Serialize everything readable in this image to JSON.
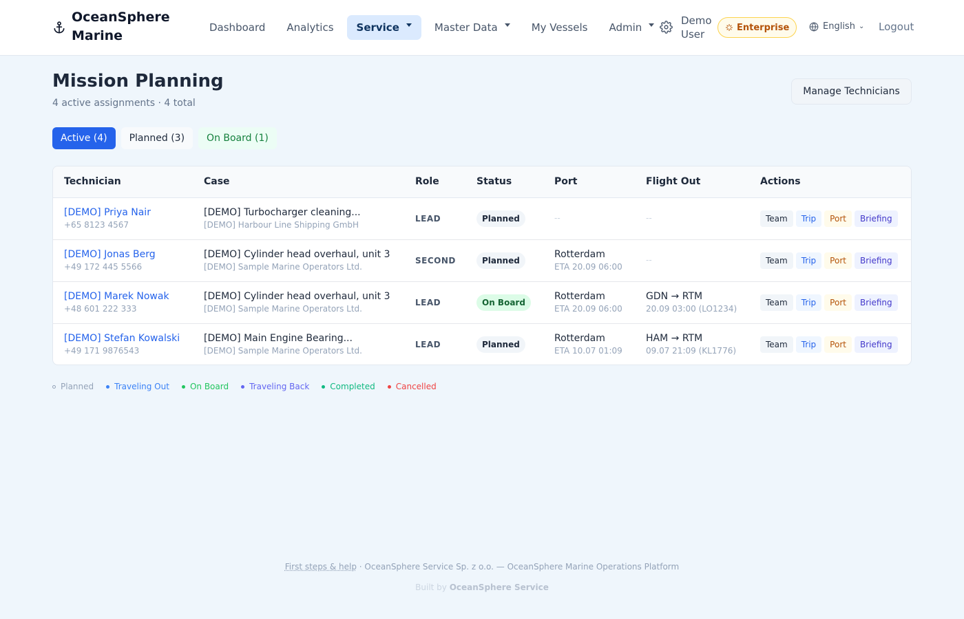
{
  "header": {
    "brand": "OceanSphere Marine",
    "nav": [
      {
        "label": "Dashboard"
      },
      {
        "label": "Analytics"
      },
      {
        "label": "Service"
      },
      {
        "label": "Master Data"
      },
      {
        "label": "My Vessels"
      },
      {
        "label": "Admin"
      }
    ],
    "user": "Demo User",
    "plan_badge": "Enterprise",
    "language": "English",
    "logout": "Logout"
  },
  "page": {
    "title": "Mission Planning",
    "subtitle": "4 active assignments · 4 total",
    "manage_button": "Manage Technicians"
  },
  "tabs": [
    {
      "label": "Active (4)"
    },
    {
      "label": "Planned (3)"
    },
    {
      "label": "On Board (1)"
    }
  ],
  "table": {
    "columns": [
      "Technician",
      "Case",
      "Role",
      "Status",
      "Port",
      "Flight Out",
      "Actions"
    ],
    "action_labels": [
      "Team",
      "Trip",
      "Port",
      "Briefing"
    ],
    "rows": [
      {
        "technician": "[DEMO] Priya Nair",
        "phone": "+65 8123 4567",
        "case": "[DEMO] Turbocharger cleaning...",
        "company": "[DEMO] Harbour Line Shipping GmbH",
        "role": "LEAD",
        "status": "Planned",
        "port": "--",
        "eta": "",
        "flight": "--",
        "flight_detail": ""
      },
      {
        "technician": "[DEMO] Jonas Berg",
        "phone": "+49 172 445 5566",
        "case": "[DEMO] Cylinder head overhaul, unit 3",
        "company": "[DEMO] Sample Marine Operators Ltd.",
        "role": "SECOND",
        "status": "Planned",
        "port": "Rotterdam",
        "eta": "ETA 20.09 06:00",
        "flight": "--",
        "flight_detail": ""
      },
      {
        "technician": "[DEMO] Marek Nowak",
        "phone": "+48 601 222 333",
        "case": "[DEMO] Cylinder head overhaul, unit 3",
        "company": "[DEMO] Sample Marine Operators Ltd.",
        "role": "LEAD",
        "status": "On Board",
        "port": "Rotterdam",
        "eta": "ETA 20.09 06:00",
        "flight": "GDN → RTM",
        "flight_detail": "20.09 03:00 (LO1234)"
      },
      {
        "technician": "[DEMO] Stefan Kowalski",
        "phone": "+49 171 9876543",
        "case": "[DEMO] Main Engine Bearing...",
        "company": "[DEMO] Sample Marine Operators Ltd.",
        "role": "LEAD",
        "status": "Planned",
        "port": "Rotterdam",
        "eta": "ETA 10.07 01:09",
        "flight": "HAM → RTM",
        "flight_detail": "09.07 21:09 (KL1776)"
      }
    ]
  },
  "legend": [
    {
      "label": "Planned",
      "color": "#94a3b8"
    },
    {
      "label": "Traveling Out",
      "color": "#3b82f6"
    },
    {
      "label": "On Board",
      "color": "#22c55e"
    },
    {
      "label": "Traveling Back",
      "color": "#6366f1"
    },
    {
      "label": "Completed",
      "color": "#10b981"
    },
    {
      "label": "Cancelled",
      "color": "#ef4444"
    }
  ],
  "footer": {
    "help_link": "First steps & help",
    "line": " · OceanSphere Service Sp. z o.o. — OceanSphere Marine Operations Platform",
    "built_by_prefix": "Built by ",
    "built_by_name": "OceanSphere Service"
  },
  "colors": {
    "accent": "#2563eb",
    "background": "#eff6fc"
  }
}
